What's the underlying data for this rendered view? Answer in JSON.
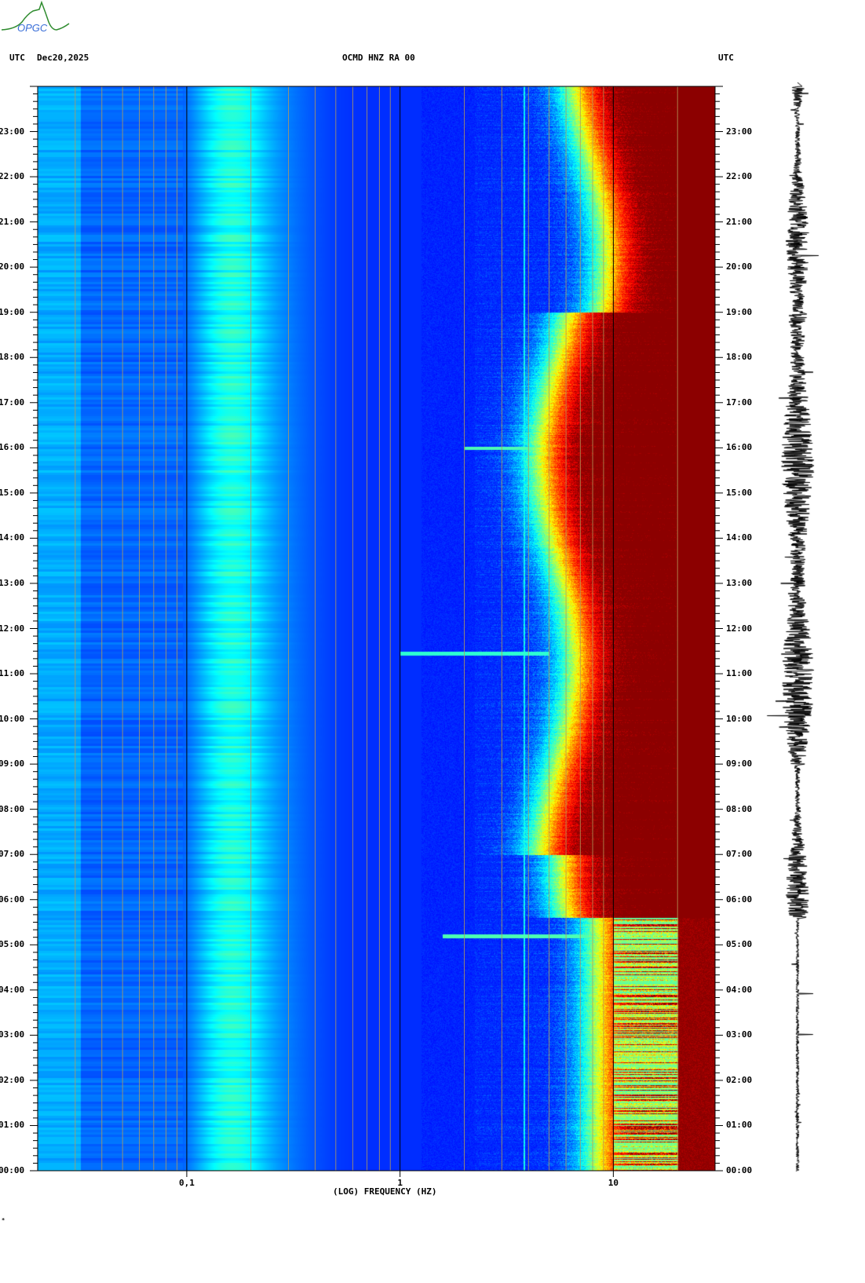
{
  "logo": {
    "text": "OPGC"
  },
  "header": {
    "left_tz": "UTC",
    "date": "Dec20,2025",
    "station": "OCMD HNZ RA 00",
    "right_tz": "UTC"
  },
  "footer_mark": "*",
  "chart_data": {
    "type": "heatmap",
    "title": "OCMD HNZ RA 00",
    "xlabel": "(LOG) FREQUENCY (HZ)",
    "ylabel": "UTC",
    "x_scale": "log",
    "xlim": [
      0.02,
      30
    ],
    "x_ticks": [
      {
        "value": 0.1,
        "label": "0,1"
      },
      {
        "value": 1,
        "label": "1"
      },
      {
        "value": 10,
        "label": "10"
      }
    ],
    "ylim_hours": [
      0,
      24
    ],
    "y_ticks": [
      "00:00",
      "01:00",
      "02:00",
      "03:00",
      "04:00",
      "05:00",
      "06:00",
      "07:00",
      "08:00",
      "09:00",
      "10:00",
      "11:00",
      "12:00",
      "13:00",
      "14:00",
      "15:00",
      "16:00",
      "17:00",
      "18:00",
      "19:00",
      "20:00",
      "21:00",
      "22:00",
      "23:00"
    ],
    "colormap": "jet",
    "features": [
      {
        "name": "microseism band",
        "freq_range_hz": [
          0.12,
          0.25
        ],
        "hours": [
          0,
          24
        ],
        "level": "cyan"
      },
      {
        "name": "steady line",
        "freq_hz": 3.8,
        "hours": [
          0,
          24
        ]
      },
      {
        "name": "cultural noise onset",
        "freq_min_hz": 6,
        "hours": [
          5.6,
          24
        ],
        "level": "red"
      },
      {
        "name": "night quiet",
        "freq_min_hz": 20,
        "hours": [
          0,
          5.6
        ],
        "level": "dark red"
      },
      {
        "name": "transient",
        "freq_range_hz": [
          2,
          6
        ],
        "hour": 16.0
      },
      {
        "name": "transient",
        "freq_range_hz": [
          1,
          5
        ],
        "hour": 11.45
      },
      {
        "name": "transient",
        "freq_range_hz": [
          1.5,
          12
        ],
        "hour": 5.2
      }
    ],
    "seismogram": {
      "hours": [
        0,
        24
      ],
      "quiet_until_hour": 5.6
    }
  }
}
